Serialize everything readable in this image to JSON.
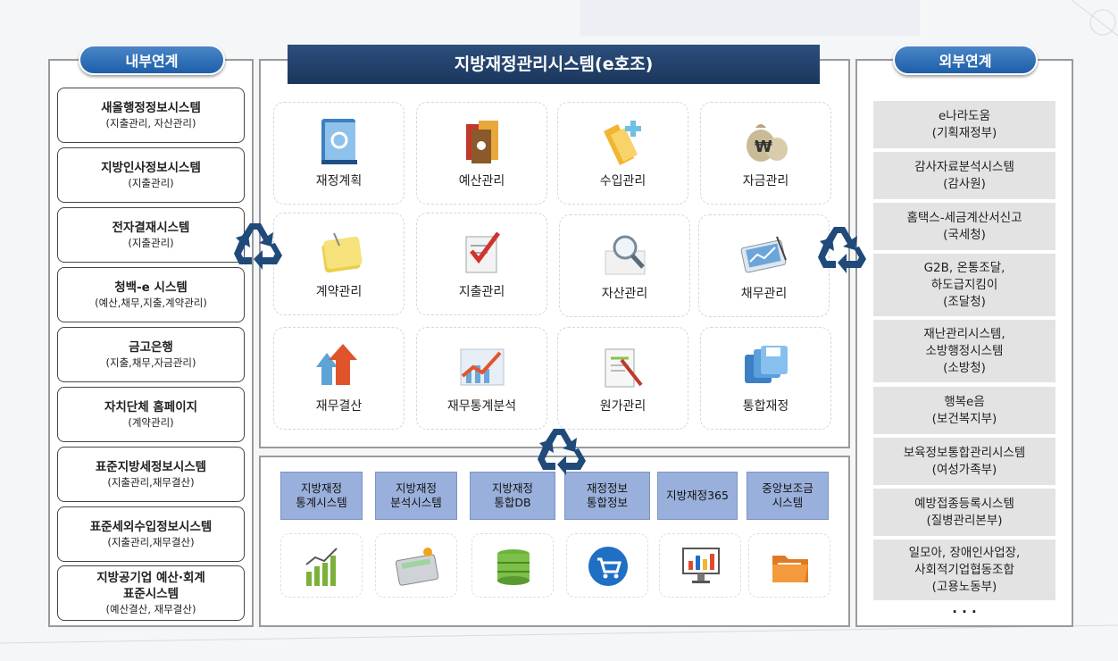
{
  "left_panel": {
    "title": "내부연계",
    "items": [
      {
        "title": "새올행정정보시스템",
        "sub": "(지출관리,  자산관리)"
      },
      {
        "title": "지방인사정보시스템",
        "sub": "(지출관리)"
      },
      {
        "title": "전자결재시스템",
        "sub": "(지출관리)"
      },
      {
        "title": "청백-e 시스템",
        "sub": "(예산,채무,지출,계약관리)"
      },
      {
        "title": "금고은행",
        "sub": "(지출,채무,자금관리)"
      },
      {
        "title": "자치단체 홈페이지",
        "sub": "(계약관리)"
      },
      {
        "title": "표준지방세정보시스템",
        "sub": "(지출관리,재무결산)"
      },
      {
        "title": "표준세외수입정보시스템",
        "sub": "(지출관리,재무결산)"
      },
      {
        "title": "지방공기업  예산·회계",
        "title2": "표준시스템",
        "sub": "(예산결산,  재무결산)"
      }
    ]
  },
  "center": {
    "title": "지방재정관리시스템(e호조)",
    "modules": [
      {
        "label": "재정계획",
        "icon": "book-icon"
      },
      {
        "label": "예산관리",
        "icon": "documents-icon"
      },
      {
        "label": "수입관리",
        "icon": "folder-plus-icon"
      },
      {
        "label": "자금관리",
        "icon": "money-bag-icon"
      },
      {
        "label": "계약관리",
        "icon": "note-icon"
      },
      {
        "label": "지출관리",
        "icon": "checklist-icon"
      },
      {
        "label": "자산관리",
        "icon": "magnifier-icon"
      },
      {
        "label": "채무관리",
        "icon": "tablet-chart-icon"
      },
      {
        "label": "재무결산",
        "icon": "up-arrows-icon"
      },
      {
        "label": "재무통계분석",
        "icon": "trend-chart-icon"
      },
      {
        "label": "원가관리",
        "icon": "document-pen-icon"
      },
      {
        "label": "통합재정",
        "icon": "floppy-disks-icon"
      }
    ],
    "systems": [
      {
        "label": "지방재정\n통계시스템",
        "icon": "bar-chart-icon"
      },
      {
        "label": "지방재정\n분석시스템",
        "icon": "calculator-icon"
      },
      {
        "label": "지방재정\n통합DB",
        "icon": "database-icon"
      },
      {
        "label": "재정정보\n통합정보",
        "icon": "shopping-cart-icon"
      },
      {
        "label": "지방재정365",
        "icon": "monitor-chart-icon"
      },
      {
        "label": "중앙보조금\n시스템",
        "icon": "folder-icon"
      }
    ]
  },
  "right_panel": {
    "title": "외부연계",
    "items": [
      {
        "lines": [
          "e나라도움",
          "(기획재정부)"
        ]
      },
      {
        "lines": [
          "감사자료분석시스템",
          "(감사원)"
        ]
      },
      {
        "lines": [
          "홈택스-세금계산서신고",
          "(국세청)"
        ]
      },
      {
        "lines": [
          "G2B, 온통조달,",
          "하도급지킴이",
          "(조달청)"
        ]
      },
      {
        "lines": [
          "재난관리시스템,",
          "소방행정시스템",
          "(소방청)"
        ]
      },
      {
        "lines": [
          "행복e음",
          "(보건복지부)"
        ]
      },
      {
        "lines": [
          "보육정보통합관리시스템",
          "(여성가족부)"
        ]
      },
      {
        "lines": [
          "예방접종등록시스템",
          "(질병관리본부)"
        ]
      },
      {
        "lines": [
          "일모아, 장애인사업장,",
          "사회적기업협동조합",
          "(고용노동부)"
        ]
      }
    ],
    "ellipsis": "· · ·"
  },
  "colors": {
    "accent": "#1d5fa8",
    "title_bar": "#1f3d66",
    "system_box": "#9ab0dc",
    "recycle": "#1f4a7a"
  }
}
